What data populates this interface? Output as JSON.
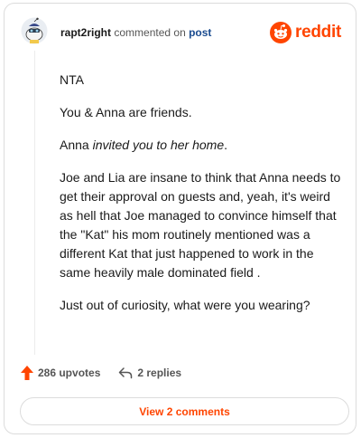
{
  "comment": {
    "username": "rapt2right",
    "action_text": "commented on",
    "post_link": "post",
    "brand": "reddit",
    "paragraphs": {
      "p1": "NTA",
      "p2": "You & Anna are friends.",
      "p3_pre": "Anna ",
      "p3_em": "invited you to her home",
      "p3_post": ".",
      "p4": "Joe and Lia are insane to think that Anna needs to get their approval on guests and, yeah, it's weird as hell that Joe managed to convince himself that the \"Kat\" his mom routinely mentioned was a different Kat that just happened to work in the same heavily male dominated field .",
      "p5": "Just out of curiosity, what were you wearing?"
    }
  },
  "actions": {
    "upvotes": "286 upvotes",
    "replies": "2 replies"
  },
  "view_comments_button": "View 2 comments",
  "colors": {
    "accent": "#ff4500",
    "link": "#1a4b8f",
    "text": "#1a1a1a",
    "border": "#dcdcdc"
  },
  "icons": [
    "snoo-avatar-icon",
    "reddit-logo-icon",
    "upvote-arrow-icon",
    "reply-arrow-icon"
  ]
}
